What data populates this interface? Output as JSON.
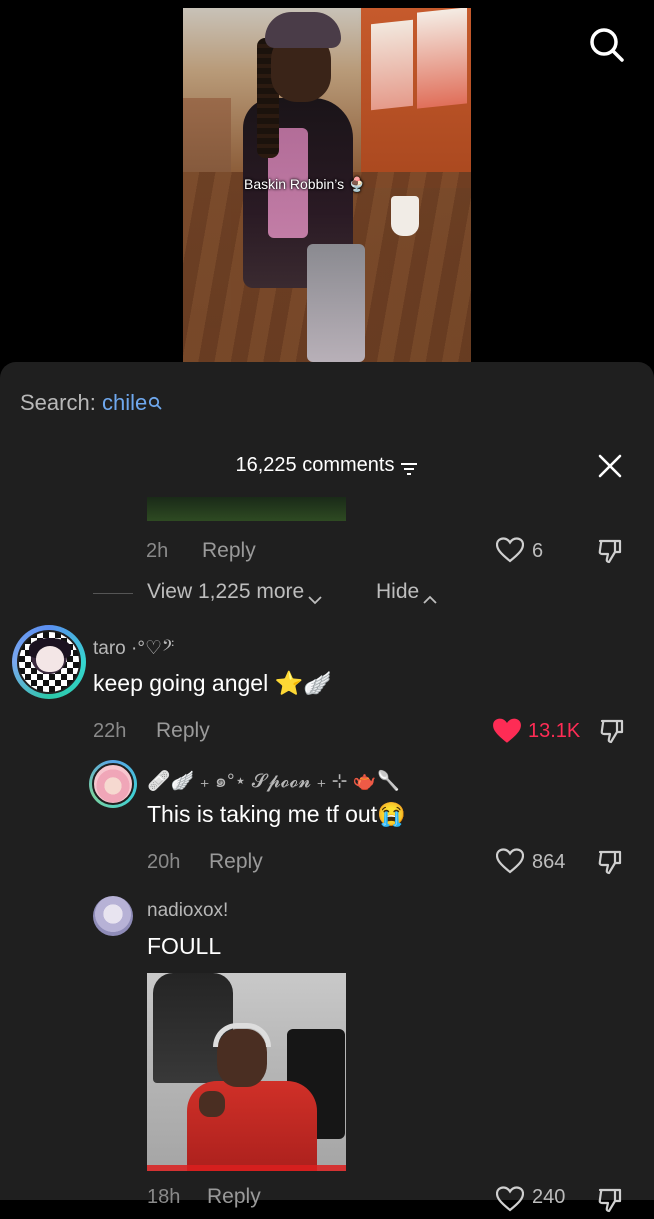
{
  "video": {
    "caption": "Baskin Robbin’s 🍨"
  },
  "search": {
    "prefix": "Search:",
    "term": "chile"
  },
  "comments_header": {
    "count_label": "16,225 comments"
  },
  "top_reply": {
    "time": "2h",
    "reply_label": "Reply",
    "likes": "6"
  },
  "thread_controls": {
    "view_more": "View 1,225 more",
    "hide": "Hide"
  },
  "comment_main": {
    "username": "taro ·°♡𝄢",
    "text": "keep going angel ⭐🪽",
    "time": "22h",
    "reply_label": "Reply",
    "likes": "13.1K",
    "liked": true,
    "liked_color": "#fe2c55"
  },
  "reply_spoon": {
    "username": "🩹🪽 ₊ ๑°⋆ 𝓢𝓹𝓸𝓸𝓷 ₊ ⊹ 🫖🥄",
    "text": "This is taking me tf out😭",
    "time": "20h",
    "reply_label": "Reply",
    "likes": "864"
  },
  "reply_nadio": {
    "username": "nadioxox!",
    "text": "FOULL",
    "time": "18h",
    "reply_label": "Reply",
    "likes": "240"
  },
  "icons": {
    "search": "search-icon",
    "close": "close-icon",
    "sort": "sort-icon",
    "heart": "heart-icon",
    "dislike": "thumbs-down-icon"
  }
}
